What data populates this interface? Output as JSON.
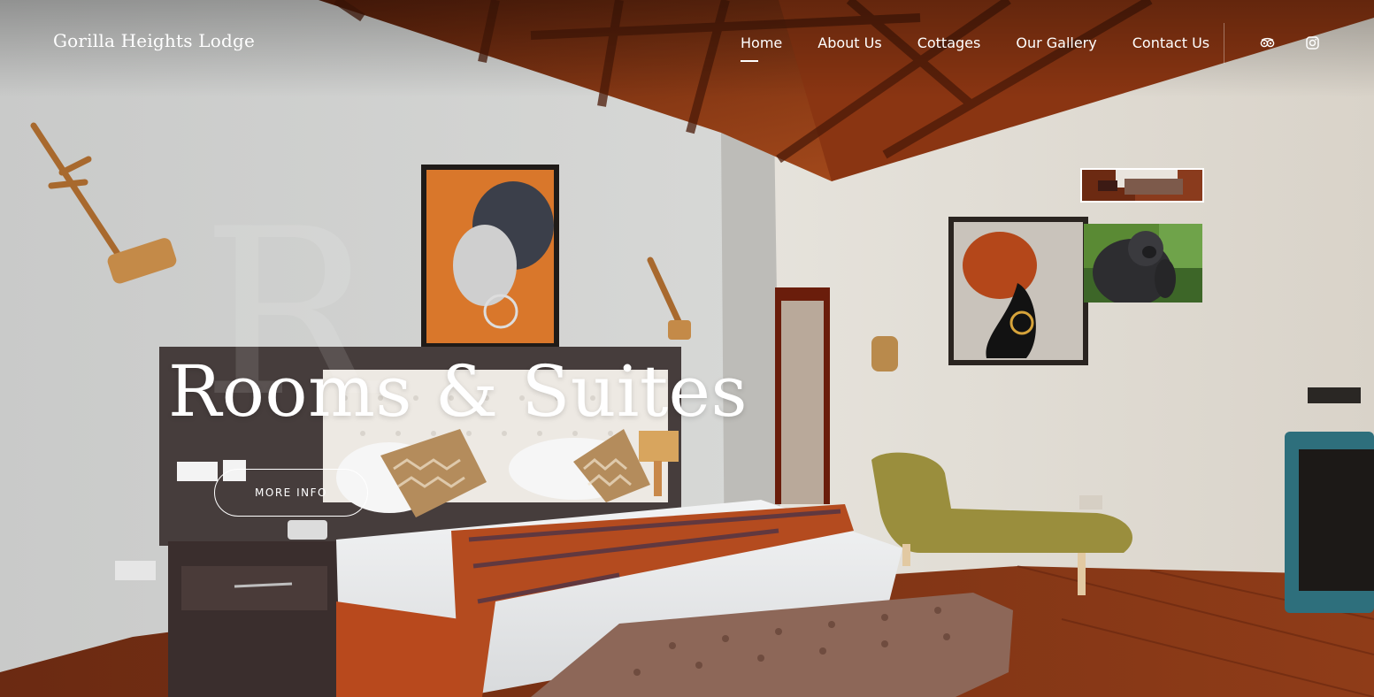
{
  "header": {
    "brand": "Gorilla Heights Lodge",
    "nav": [
      {
        "label": "Home",
        "active": true
      },
      {
        "label": "About Us",
        "active": false
      },
      {
        "label": "Cottages",
        "active": false
      },
      {
        "label": "Our Gallery",
        "active": false
      },
      {
        "label": "Contact Us",
        "active": false
      }
    ],
    "social_icons": [
      "tripadvisor-icon",
      "instagram-icon"
    ]
  },
  "hero": {
    "ghost_letter": "R",
    "title": "Rooms & Suites",
    "button_label": "MORE INFO",
    "thumbnails": [
      "bedroom-thumbnail",
      "gorilla-thumbnail"
    ]
  },
  "colors": {
    "text": "#ffffff",
    "ceiling_wood": "#7a3414",
    "wall": "#d4d4d2",
    "floor_wood": "#7a2f14"
  }
}
